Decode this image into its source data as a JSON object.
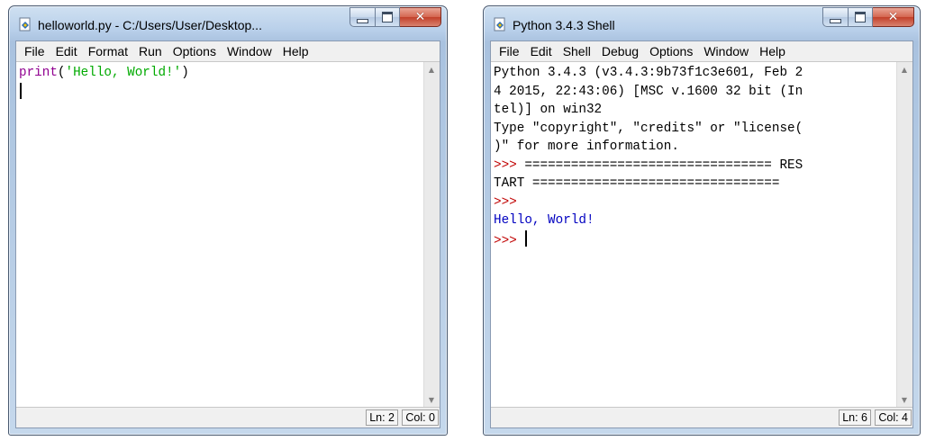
{
  "editor_window": {
    "title": "helloworld.py - C:/Users/User/Desktop...",
    "menu": [
      "File",
      "Edit",
      "Format",
      "Run",
      "Options",
      "Window",
      "Help"
    ],
    "code": {
      "keyword": "print",
      "open": "(",
      "string": "'Hello, World!'",
      "close": ")"
    },
    "status": {
      "line": "Ln: 2",
      "col": "Col: 0"
    }
  },
  "shell_window": {
    "title": "Python 3.4.3 Shell",
    "menu": [
      "File",
      "Edit",
      "Shell",
      "Debug",
      "Options",
      "Window",
      "Help"
    ],
    "lines": [
      "Python 3.4.3 (v3.4.3:9b73f1c3e601, Feb 2",
      "4 2015, 22:43:06) [MSC v.1600 32 bit (In",
      "tel)] on win32",
      "Type \"copyright\", \"credits\" or \"license(",
      ")\" for more information."
    ],
    "restart_prompt": ">>>",
    "restart_line1": " ================================ RES",
    "restart_line2": "TART ================================",
    "prompt": ">>>",
    "output": "Hello, World!",
    "status": {
      "line": "Ln: 6",
      "col": "Col: 4"
    }
  },
  "icons": {
    "app": "python-idle-icon",
    "minimize": "minimize-icon",
    "maximize": "maximize-icon",
    "close": "close-icon",
    "close_glyph": "✕",
    "scroll_up": "▲",
    "scroll_down": "▼"
  },
  "colors": {
    "keyword": "#900090",
    "string": "#00aa00",
    "output": "#0000c0",
    "prompt": "#c00000"
  }
}
